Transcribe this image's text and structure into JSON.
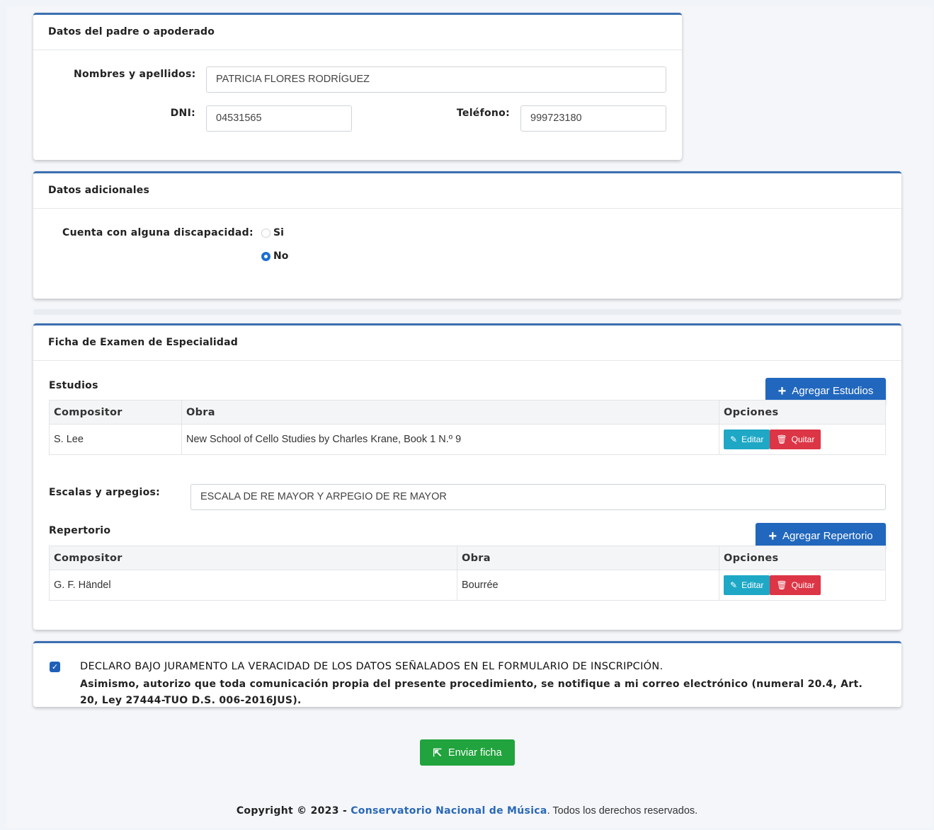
{
  "guardian": {
    "header": "Datos del padre o apoderado",
    "name_label": "Nombres y apellidos:",
    "name_value": "PATRICIA FLORES RODRÍGUEZ",
    "dni_label": "DNI:",
    "dni_value": "04531565",
    "phone_label": "Teléfono:",
    "phone_value": "999723180"
  },
  "additional": {
    "header": "Datos adicionales",
    "disability_label": "Cuenta con alguna discapacidad:",
    "options": [
      {
        "label": "Si",
        "checked": false
      },
      {
        "label": "No",
        "checked": true
      }
    ]
  },
  "exam": {
    "header": "Ficha de Examen de Especialidad",
    "studies": {
      "title": "Estudios",
      "add_button": "Agregar Estudios",
      "columns": [
        "Compositor",
        "Obra",
        "Opciones"
      ],
      "rows": [
        {
          "composer": "S. Lee",
          "work": "New School of Cello Studies by Charles Krane, Book 1 N.º 9"
        }
      ]
    },
    "scales": {
      "label": "Escalas y arpegios:",
      "value": "ESCALA DE RE MAYOR Y ARPEGIO DE RE MAYOR"
    },
    "repertoire": {
      "title": "Repertorio",
      "add_button": "Agregar Repertorio",
      "columns": [
        "Compositor",
        "Obra",
        "Opciones"
      ],
      "rows": [
        {
          "composer": "G. F. Händel",
          "work": "Bourrée"
        }
      ]
    },
    "edit_label": "Editar",
    "remove_label": "Quitar"
  },
  "declaration": {
    "checked": true,
    "title": "DECLARO BAJO JURAMENTO LA VERACIDAD DE LOS DATOS SEÑALADOS EN EL FORMULARIO DE INSCRIPCIÓN.",
    "body": "Asimismo, autorizo que toda comunicación propia del presente procedimiento, se notifique a mi correo electrónico (numeral 20.4, Art. 20, Ley 27444-TUO D.S. 006-2016JUS)."
  },
  "submit_label": "Enviar ficha",
  "footer": {
    "prefix": "Copyright © 2023 - ",
    "link": "Conservatorio Nacional de Música",
    "suffix": ". Todos los derechos reservados."
  },
  "colors": {
    "primary": "#2167bd",
    "card_accent": "#3c6fb0",
    "edit": "#1ea8c6",
    "delete": "#dc3545",
    "success": "#21a33d"
  }
}
